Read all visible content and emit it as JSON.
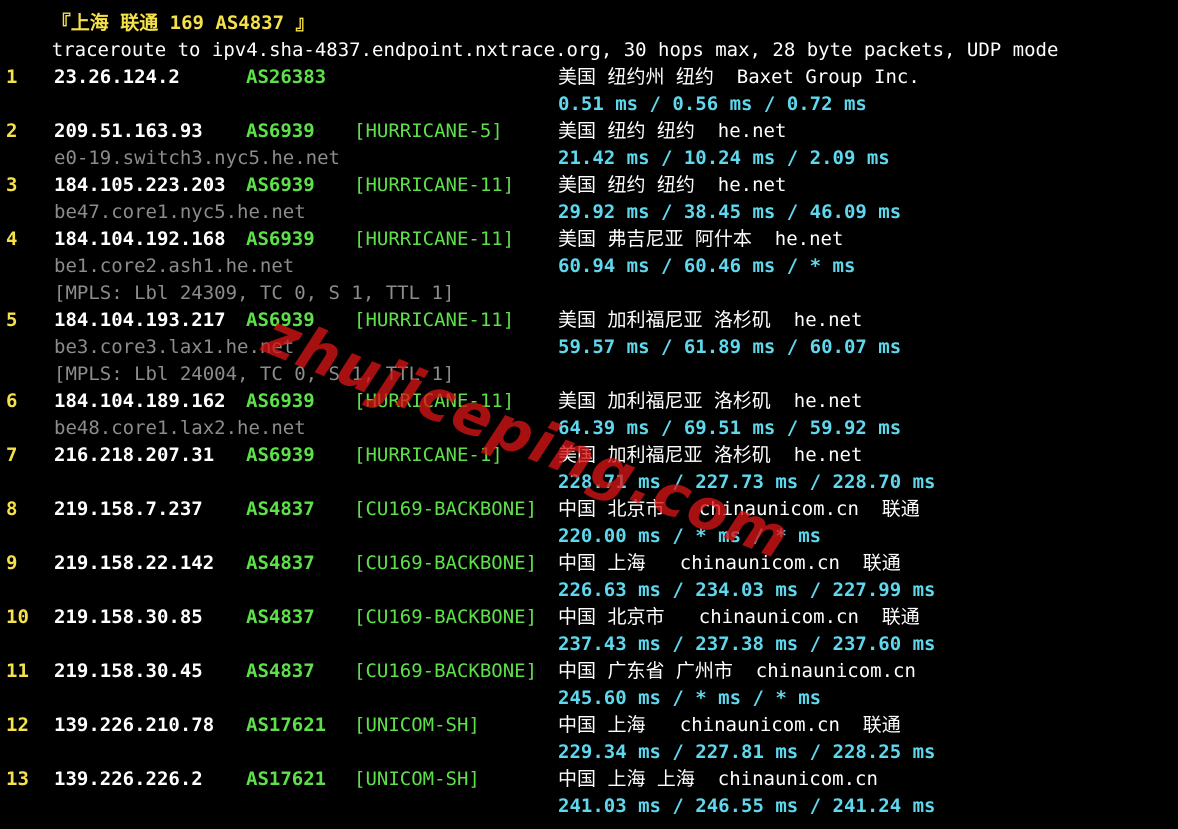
{
  "title": "『上海 联通 169 AS4837 』",
  "header": "traceroute to ipv4.sha-4837.endpoint.nxtrace.org, 30 hops max, 28 byte packets, UDP mode",
  "hops": [
    {
      "hop": "1",
      "ip": "23.26.124.2",
      "asn": "AS26383",
      "tag": "",
      "geo": "美国 纽约州 纽约  Baxet Group Inc.",
      "rdns": "",
      "mpls": "",
      "rtt": "0.51 ms / 0.56 ms / 0.72 ms"
    },
    {
      "hop": "2",
      "ip": "209.51.163.93",
      "asn": "AS6939",
      "tag": "[HURRICANE-5]",
      "geo": "美国 纽约 纽约  he.net",
      "rdns": "e0-19.switch3.nyc5.he.net",
      "mpls": "",
      "rtt": "21.42 ms / 10.24 ms / 2.09 ms"
    },
    {
      "hop": "3",
      "ip": "184.105.223.203",
      "asn": "AS6939",
      "tag": "[HURRICANE-11]",
      "geo": "美国 纽约 纽约  he.net",
      "rdns": "be47.core1.nyc5.he.net",
      "mpls": "",
      "rtt": "29.92 ms / 38.45 ms / 46.09 ms"
    },
    {
      "hop": "4",
      "ip": "184.104.192.168",
      "asn": "AS6939",
      "tag": "[HURRICANE-11]",
      "geo": "美国 弗吉尼亚 阿什本  he.net",
      "rdns": "be1.core2.ash1.he.net",
      "mpls": "[MPLS: Lbl 24309, TC 0, S 1, TTL 1]",
      "rtt": "60.94 ms / 60.46 ms / * ms"
    },
    {
      "hop": "5",
      "ip": "184.104.193.217",
      "asn": "AS6939",
      "tag": "[HURRICANE-11]",
      "geo": "美国 加利福尼亚 洛杉矶  he.net",
      "rdns": "be3.core3.lax1.he.net",
      "mpls": "[MPLS: Lbl 24004, TC 0, S 1, TTL 1]",
      "rtt": "59.57 ms / 61.89 ms / 60.07 ms"
    },
    {
      "hop": "6",
      "ip": "184.104.189.162",
      "asn": "AS6939",
      "tag": "[HURRICANE-11]",
      "geo": "美国 加利福尼亚 洛杉矶  he.net",
      "rdns": "be48.core1.lax2.he.net",
      "mpls": "",
      "rtt": "64.39 ms / 69.51 ms / 59.92 ms"
    },
    {
      "hop": "7",
      "ip": "216.218.207.31",
      "asn": "AS6939",
      "tag": "[HURRICANE-1]",
      "geo": "美国 加利福尼亚 洛杉矶  he.net",
      "rdns": "",
      "mpls": "",
      "rtt": "228.71 ms / 227.73 ms / 228.70 ms"
    },
    {
      "hop": "8",
      "ip": "219.158.7.237",
      "asn": "AS4837",
      "tag": "[CU169-BACKBONE]",
      "geo": "中国 北京市   chinaunicom.cn  联通",
      "rdns": "",
      "mpls": "",
      "rtt": "220.00 ms / * ms / * ms"
    },
    {
      "hop": "9",
      "ip": "219.158.22.142",
      "asn": "AS4837",
      "tag": "[CU169-BACKBONE]",
      "geo": "中国 上海   chinaunicom.cn  联通",
      "rdns": "",
      "mpls": "",
      "rtt": "226.63 ms / 234.03 ms / 227.99 ms"
    },
    {
      "hop": "10",
      "ip": "219.158.30.85",
      "asn": "AS4837",
      "tag": "[CU169-BACKBONE]",
      "geo": "中国 北京市   chinaunicom.cn  联通",
      "rdns": "",
      "mpls": "",
      "rtt": "237.43 ms / 237.38 ms / 237.60 ms"
    },
    {
      "hop": "11",
      "ip": "219.158.30.45",
      "asn": "AS4837",
      "tag": "[CU169-BACKBONE]",
      "geo": "中国 广东省 广州市  chinaunicom.cn",
      "rdns": "",
      "mpls": "",
      "rtt": "245.60 ms / * ms / * ms"
    },
    {
      "hop": "12",
      "ip": "139.226.210.78",
      "asn": "AS17621",
      "tag": "[UNICOM-SH]",
      "geo": "中国 上海   chinaunicom.cn  联通",
      "rdns": "",
      "mpls": "",
      "rtt": "229.34 ms / 227.81 ms / 228.25 ms"
    },
    {
      "hop": "13",
      "ip": "139.226.226.2",
      "asn": "AS17621",
      "tag": "[UNICOM-SH]",
      "geo": "中国 上海 上海  chinaunicom.cn",
      "rdns": "",
      "mpls": "",
      "rtt": "241.03 ms / 246.55 ms / 241.24 ms"
    }
  ],
  "watermark": "zhujiceping.com",
  "colors": {
    "background": "#000000",
    "hop": "#f5e14a",
    "asn": "#5ee04a",
    "rtt": "#5fd8ee",
    "rdns": "#8c8c8c"
  }
}
